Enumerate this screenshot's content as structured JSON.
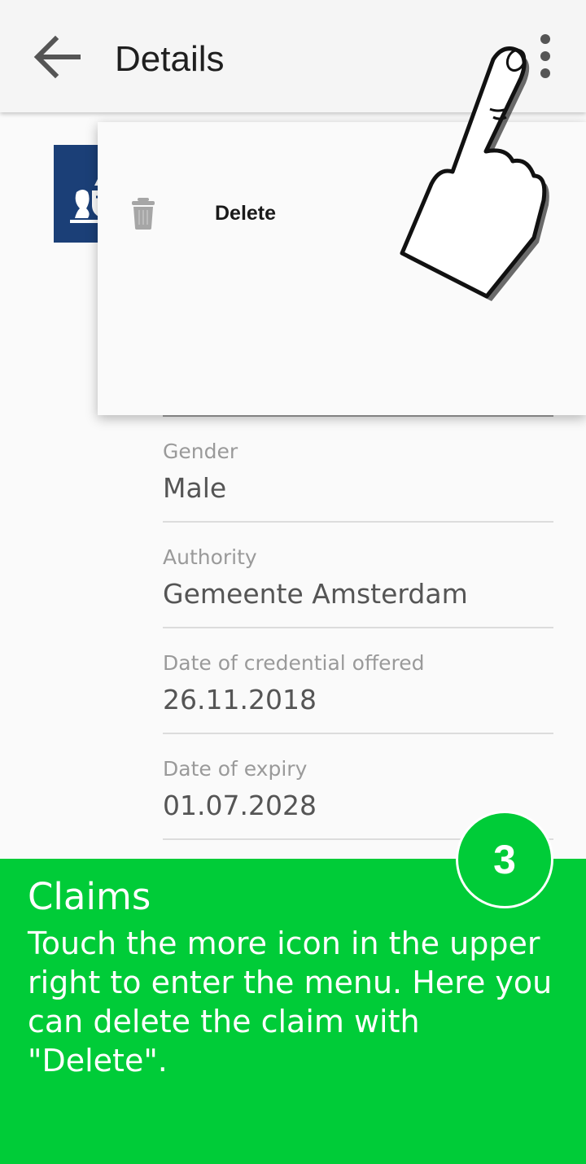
{
  "appbar": {
    "back_icon": "arrow-left-icon",
    "title": "Details",
    "more_icon": "more-vertical-icon"
  },
  "logo": {
    "icon": "coat-of-arms-logo",
    "color": "#1b3f77"
  },
  "menu": {
    "items": [
      {
        "icon": "trash-icon",
        "label": "Delete"
      }
    ]
  },
  "fields": [
    {
      "label": "Gender",
      "value": "Male"
    },
    {
      "label": "Authority",
      "value": "Gemeente Amsterdam"
    },
    {
      "label": "Date of credential offered",
      "value": "26.11.2018"
    },
    {
      "label": "Date of expiry",
      "value": "01.07.2028"
    }
  ],
  "tutorial": {
    "step": "3",
    "title": "Claims",
    "text": "Touch the more icon in the upper right to enter the menu. Here you can delete the claim with \"Delete\".",
    "color": "#00cc38",
    "pointer_icon": "pointing-hand-icon"
  }
}
